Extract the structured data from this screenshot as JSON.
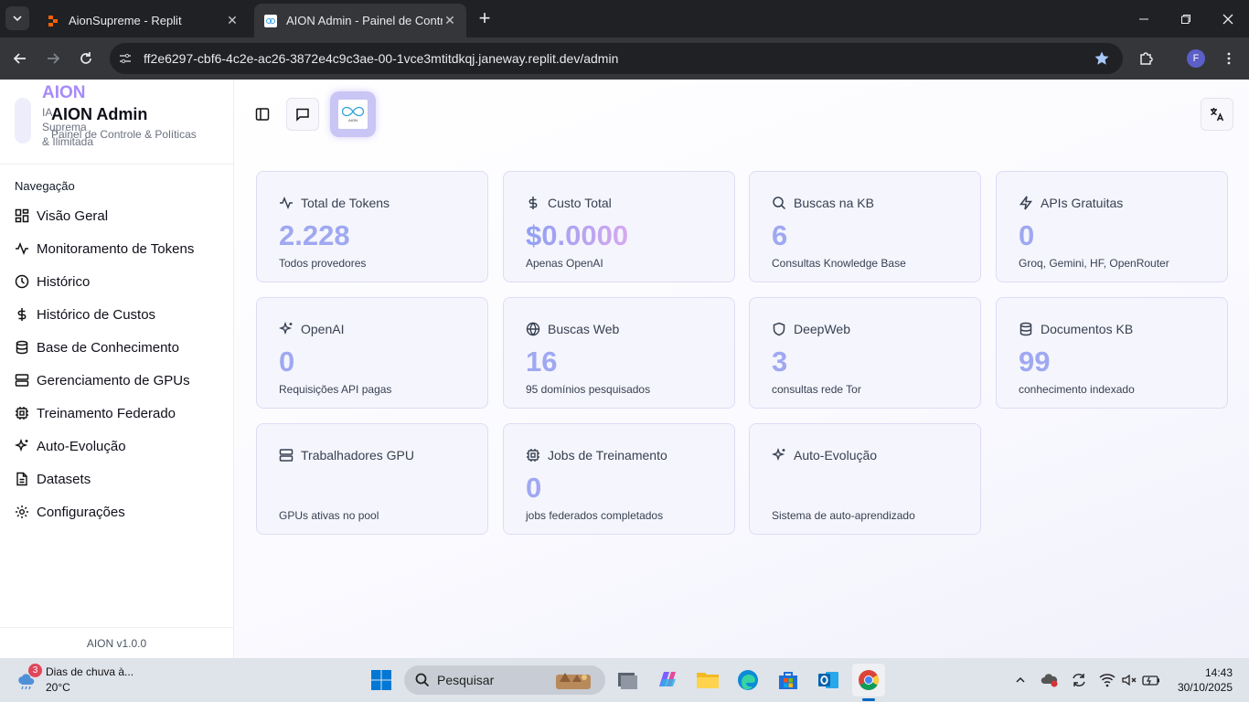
{
  "browser": {
    "tabs": [
      {
        "title": "AionSupreme - Replit",
        "active": false
      },
      {
        "title": "AION Admin - Painel de Controle",
        "active": true
      }
    ],
    "url": "ff2e6297-cbf6-4c2e-ac26-3872e4c9c3ae-00-1vce3mtitdkqj.janeway.replit.dev/admin",
    "profile_initial": "F"
  },
  "sidebar": {
    "brand": "AION",
    "brand_sub": "IA Suprema & Ilimitada",
    "title": "AION Admin",
    "caption": "Painel de Controle & Políticas",
    "section_label": "Navegação",
    "items": [
      {
        "label": "Visão Geral",
        "icon": "grid-icon"
      },
      {
        "label": "Monitoramento de Tokens",
        "icon": "activity-icon"
      },
      {
        "label": "Histórico",
        "icon": "clock-icon"
      },
      {
        "label": "Histórico de Custos",
        "icon": "dollar-icon"
      },
      {
        "label": "Base de Conhecimento",
        "icon": "database-icon"
      },
      {
        "label": "Gerenciamento de GPUs",
        "icon": "server-icon"
      },
      {
        "label": "Treinamento Federado",
        "icon": "cpu-icon"
      },
      {
        "label": "Auto-Evolução",
        "icon": "sparkles-icon"
      },
      {
        "label": "Datasets",
        "icon": "file-icon"
      },
      {
        "label": "Configurações",
        "icon": "gear-icon"
      }
    ],
    "version": "AION v1.0.0"
  },
  "header": {
    "logo_text": "AION"
  },
  "cards": [
    {
      "title": "Total de Tokens",
      "value": "2.228",
      "desc": "Todos provedores",
      "icon": "activity-icon"
    },
    {
      "title": "Custo Total",
      "value": "$0.0000",
      "desc": "Apenas OpenAI",
      "icon": "dollar-icon"
    },
    {
      "title": "Buscas na KB",
      "value": "6",
      "desc": "Consultas Knowledge Base",
      "icon": "search-icon"
    },
    {
      "title": "APIs Gratuitas",
      "value": "0",
      "desc": "Groq, Gemini, HF, OpenRouter",
      "icon": "zap-icon"
    },
    {
      "title": "OpenAI",
      "value": "0",
      "desc": "Requisições API pagas",
      "icon": "sparkles-icon"
    },
    {
      "title": "Buscas Web",
      "value": "16",
      "desc": "95 domínios pesquisados",
      "icon": "globe-icon"
    },
    {
      "title": "DeepWeb",
      "value": "3",
      "desc": "consultas rede Tor",
      "icon": "shield-icon"
    },
    {
      "title": "Documentos KB",
      "value": "99",
      "desc": "conhecimento indexado",
      "icon": "database-icon"
    },
    {
      "title": "Trabalhadores GPU",
      "value": "",
      "desc": "GPUs ativas no pool",
      "icon": "server-icon"
    },
    {
      "title": "Jobs de Treinamento",
      "value": "0",
      "desc": "jobs federados completados",
      "icon": "cpu-icon"
    },
    {
      "title": "Auto-Evolução",
      "value": "",
      "desc": "Sistema de auto-aprendizado",
      "icon": "sparkles-icon"
    }
  ],
  "taskbar": {
    "weather_badge": "3",
    "weather_line1": "Dias de chuva à...",
    "weather_line2": "20°C",
    "search_placeholder": "Pesquisar",
    "time": "14:43",
    "date": "30/10/2025"
  }
}
